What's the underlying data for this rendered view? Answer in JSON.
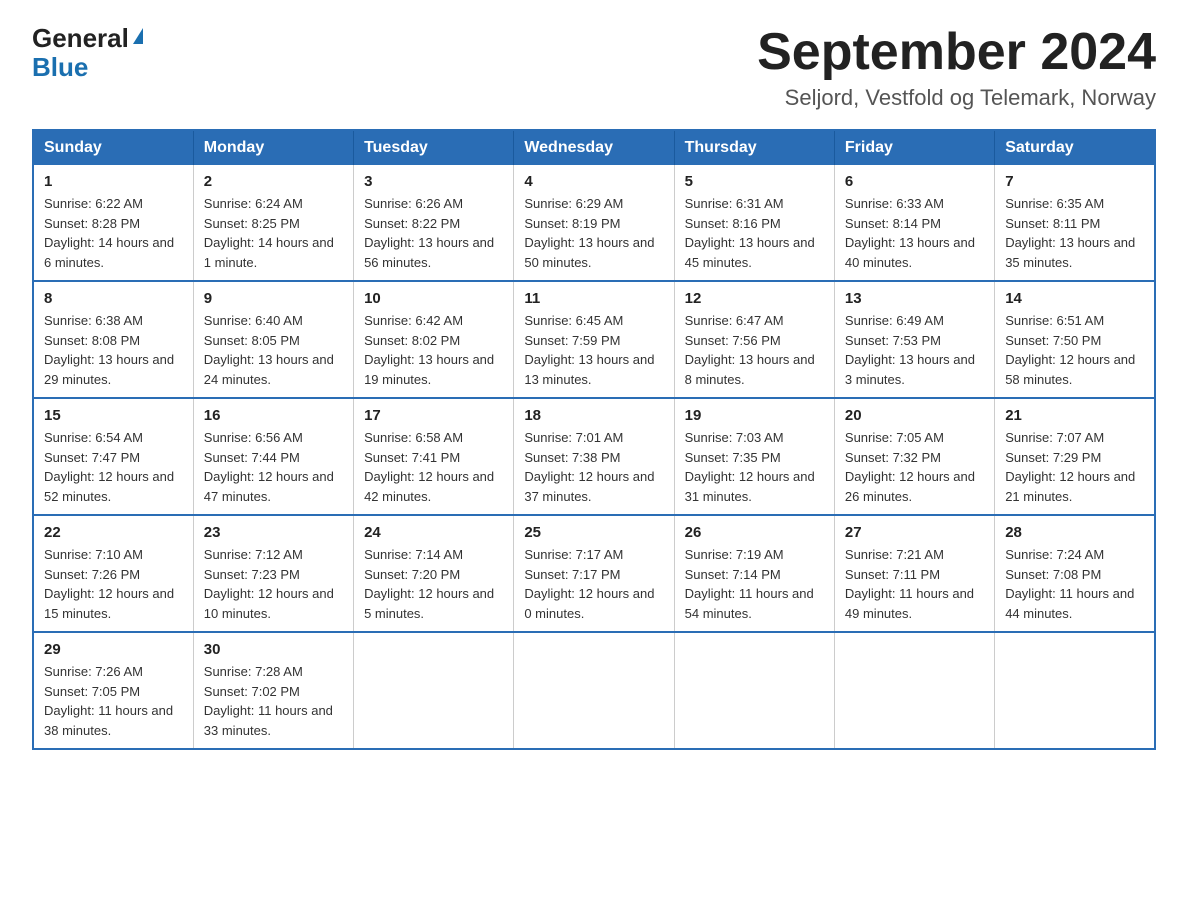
{
  "logo": {
    "general": "General",
    "blue": "Blue"
  },
  "title": "September 2024",
  "location": "Seljord, Vestfold og Telemark, Norway",
  "days": [
    "Sunday",
    "Monday",
    "Tuesday",
    "Wednesday",
    "Thursday",
    "Friday",
    "Saturday"
  ],
  "weeks": [
    [
      {
        "day": "1",
        "sunrise": "6:22 AM",
        "sunset": "8:28 PM",
        "daylight": "14 hours and 6 minutes."
      },
      {
        "day": "2",
        "sunrise": "6:24 AM",
        "sunset": "8:25 PM",
        "daylight": "14 hours and 1 minute."
      },
      {
        "day": "3",
        "sunrise": "6:26 AM",
        "sunset": "8:22 PM",
        "daylight": "13 hours and 56 minutes."
      },
      {
        "day": "4",
        "sunrise": "6:29 AM",
        "sunset": "8:19 PM",
        "daylight": "13 hours and 50 minutes."
      },
      {
        "day": "5",
        "sunrise": "6:31 AM",
        "sunset": "8:16 PM",
        "daylight": "13 hours and 45 minutes."
      },
      {
        "day": "6",
        "sunrise": "6:33 AM",
        "sunset": "8:14 PM",
        "daylight": "13 hours and 40 minutes."
      },
      {
        "day": "7",
        "sunrise": "6:35 AM",
        "sunset": "8:11 PM",
        "daylight": "13 hours and 35 minutes."
      }
    ],
    [
      {
        "day": "8",
        "sunrise": "6:38 AM",
        "sunset": "8:08 PM",
        "daylight": "13 hours and 29 minutes."
      },
      {
        "day": "9",
        "sunrise": "6:40 AM",
        "sunset": "8:05 PM",
        "daylight": "13 hours and 24 minutes."
      },
      {
        "day": "10",
        "sunrise": "6:42 AM",
        "sunset": "8:02 PM",
        "daylight": "13 hours and 19 minutes."
      },
      {
        "day": "11",
        "sunrise": "6:45 AM",
        "sunset": "7:59 PM",
        "daylight": "13 hours and 13 minutes."
      },
      {
        "day": "12",
        "sunrise": "6:47 AM",
        "sunset": "7:56 PM",
        "daylight": "13 hours and 8 minutes."
      },
      {
        "day": "13",
        "sunrise": "6:49 AM",
        "sunset": "7:53 PM",
        "daylight": "13 hours and 3 minutes."
      },
      {
        "day": "14",
        "sunrise": "6:51 AM",
        "sunset": "7:50 PM",
        "daylight": "12 hours and 58 minutes."
      }
    ],
    [
      {
        "day": "15",
        "sunrise": "6:54 AM",
        "sunset": "7:47 PM",
        "daylight": "12 hours and 52 minutes."
      },
      {
        "day": "16",
        "sunrise": "6:56 AM",
        "sunset": "7:44 PM",
        "daylight": "12 hours and 47 minutes."
      },
      {
        "day": "17",
        "sunrise": "6:58 AM",
        "sunset": "7:41 PM",
        "daylight": "12 hours and 42 minutes."
      },
      {
        "day": "18",
        "sunrise": "7:01 AM",
        "sunset": "7:38 PM",
        "daylight": "12 hours and 37 minutes."
      },
      {
        "day": "19",
        "sunrise": "7:03 AM",
        "sunset": "7:35 PM",
        "daylight": "12 hours and 31 minutes."
      },
      {
        "day": "20",
        "sunrise": "7:05 AM",
        "sunset": "7:32 PM",
        "daylight": "12 hours and 26 minutes."
      },
      {
        "day": "21",
        "sunrise": "7:07 AM",
        "sunset": "7:29 PM",
        "daylight": "12 hours and 21 minutes."
      }
    ],
    [
      {
        "day": "22",
        "sunrise": "7:10 AM",
        "sunset": "7:26 PM",
        "daylight": "12 hours and 15 minutes."
      },
      {
        "day": "23",
        "sunrise": "7:12 AM",
        "sunset": "7:23 PM",
        "daylight": "12 hours and 10 minutes."
      },
      {
        "day": "24",
        "sunrise": "7:14 AM",
        "sunset": "7:20 PM",
        "daylight": "12 hours and 5 minutes."
      },
      {
        "day": "25",
        "sunrise": "7:17 AM",
        "sunset": "7:17 PM",
        "daylight": "12 hours and 0 minutes."
      },
      {
        "day": "26",
        "sunrise": "7:19 AM",
        "sunset": "7:14 PM",
        "daylight": "11 hours and 54 minutes."
      },
      {
        "day": "27",
        "sunrise": "7:21 AM",
        "sunset": "7:11 PM",
        "daylight": "11 hours and 49 minutes."
      },
      {
        "day": "28",
        "sunrise": "7:24 AM",
        "sunset": "7:08 PM",
        "daylight": "11 hours and 44 minutes."
      }
    ],
    [
      {
        "day": "29",
        "sunrise": "7:26 AM",
        "sunset": "7:05 PM",
        "daylight": "11 hours and 38 minutes."
      },
      {
        "day": "30",
        "sunrise": "7:28 AM",
        "sunset": "7:02 PM",
        "daylight": "11 hours and 33 minutes."
      },
      null,
      null,
      null,
      null,
      null
    ]
  ]
}
